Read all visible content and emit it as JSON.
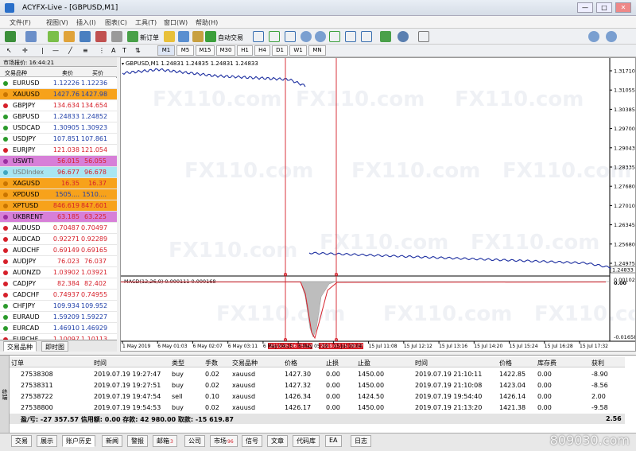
{
  "window": {
    "title": "ACYFX-Live - [GBPUSD,M1]",
    "min": "—",
    "max": "□",
    "close": "✕"
  },
  "menu": [
    "文件(F)",
    "视图(V)",
    "插入(I)",
    "图表(C)",
    "工具(T)",
    "窗口(W)",
    "帮助(H)"
  ],
  "toolbar": {
    "new_order": "新订单",
    "auto_trading": "自动交易",
    "timeframes": [
      "M1",
      "M5",
      "M15",
      "M30",
      "H1",
      "H4",
      "D1",
      "W1",
      "MN"
    ]
  },
  "market_watch": {
    "header": "市场报价: 16:44:21",
    "col_symbol": "交易品种",
    "col_bid": "卖价",
    "col_ask": "买价",
    "rows": [
      {
        "symbol": "EURUSD",
        "bid": "1.12226",
        "ask": "1.12236",
        "bg": "#ffffff",
        "dot": "#2b9a2b"
      },
      {
        "symbol": "XAUUSD",
        "bid": "1427.76",
        "ask": "1427.98",
        "bg": "#f7a21b",
        "dot": "#c87400"
      },
      {
        "symbol": "GBPJPY",
        "bid": "134.634",
        "ask": "134.654",
        "bg": "#ffffff",
        "dot": "#d6202a"
      },
      {
        "symbol": "GBPUSD",
        "bid": "1.24833",
        "ask": "1.24852",
        "bg": "#ffffff",
        "dot": "#2b9a2b"
      },
      {
        "symbol": "USDCAD",
        "bid": "1.30905",
        "ask": "1.30923",
        "bg": "#ffffff",
        "dot": "#2b9a2b"
      },
      {
        "symbol": "USDJPY",
        "bid": "107.851",
        "ask": "107.861",
        "bg": "#ffffff",
        "dot": "#2b9a2b"
      },
      {
        "symbol": "EURJPY",
        "bid": "121.038",
        "ask": "121.054",
        "bg": "#ffffff",
        "dot": "#d6202a"
      },
      {
        "symbol": "USWTI",
        "bid": "56.015",
        "ask": "56.055",
        "bg": "#d77fd8",
        "dot": "#9a2fa0"
      },
      {
        "symbol": "USDIndex",
        "bid": "96.677",
        "ask": "96.678",
        "bg": "#a8e6f2",
        "dot": "#3fa6c0"
      },
      {
        "symbol": "XAGUSD",
        "bid": "16.35",
        "ask": "16.37",
        "bg": "#f7a21b",
        "dot": "#c87400"
      },
      {
        "symbol": "XPDUSD",
        "bid": "1505....",
        "ask": "1510....",
        "bg": "#f7a21b",
        "dot": "#c87400"
      },
      {
        "symbol": "XPTUSD",
        "bid": "846.619",
        "ask": "847.601",
        "bg": "#f7a21b",
        "dot": "#c87400"
      },
      {
        "symbol": "UKBRENT",
        "bid": "63.185",
        "ask": "63.225",
        "bg": "#d77fd8",
        "dot": "#9a2fa0"
      },
      {
        "symbol": "AUDUSD",
        "bid": "0.70487",
        "ask": "0.70497",
        "bg": "#ffffff",
        "dot": "#d6202a"
      },
      {
        "symbol": "AUDCAD",
        "bid": "0.92271",
        "ask": "0.92289",
        "bg": "#ffffff",
        "dot": "#d6202a"
      },
      {
        "symbol": "AUDCHF",
        "bid": "0.69149",
        "ask": "0.69165",
        "bg": "#ffffff",
        "dot": "#d6202a"
      },
      {
        "symbol": "AUDJPY",
        "bid": "76.023",
        "ask": "76.037",
        "bg": "#ffffff",
        "dot": "#d6202a"
      },
      {
        "symbol": "AUDNZD",
        "bid": "1.03902",
        "ask": "1.03921",
        "bg": "#ffffff",
        "dot": "#d6202a"
      },
      {
        "symbol": "CADJPY",
        "bid": "82.384",
        "ask": "82.402",
        "bg": "#ffffff",
        "dot": "#d6202a"
      },
      {
        "symbol": "CADCHF",
        "bid": "0.74937",
        "ask": "0.74955",
        "bg": "#ffffff",
        "dot": "#d6202a"
      },
      {
        "symbol": "CHFJPY",
        "bid": "109.934",
        "ask": "109.952",
        "bg": "#ffffff",
        "dot": "#2b9a2b"
      },
      {
        "symbol": "EURAUD",
        "bid": "1.59209",
        "ask": "1.59227",
        "bg": "#ffffff",
        "dot": "#2b9a2b"
      },
      {
        "symbol": "EURCAD",
        "bid": "1.46910",
        "ask": "1.46929",
        "bg": "#ffffff",
        "dot": "#2b9a2b"
      },
      {
        "symbol": "EURCHF",
        "bid": "1.10097",
        "ask": "1.10113",
        "bg": "#ffffff",
        "dot": "#d6202a"
      }
    ],
    "tabs": [
      "交易品种",
      "即时图"
    ]
  },
  "chart": {
    "header": "GBPUSD,M1  1.24831 1.24835 1.24831 1.24833",
    "macd_label": "MACD(12,26,9) 0.000111 0.000168",
    "price_ticks": [
      "1.31710",
      "1.31055",
      "1.30385",
      "1.29700",
      "1.29043",
      "1.28335",
      "1.27680",
      "1.27010",
      "1.26345",
      "1.25680",
      "1.24975"
    ],
    "current_price": "1.24833",
    "macd_ticks": [
      "0.001026",
      "0.00",
      "-0.016587"
    ],
    "time_ticks": [
      "1 May 2019",
      "6 May 01:03",
      "6 May 02:07",
      "6 May 03:11",
      "6 May 04:15",
      "6 May 05:19",
      "15 Jul 10:04",
      "15 Jul 11:08",
      "15 Jul 12:12",
      "15 Jul 13:16",
      "15 Jul 14:20",
      "15 Jul 15:24",
      "15 Jul 16:28",
      "15 Jul 17:32"
    ],
    "marker1": "2019.05.06 05:14",
    "marker2": "2019.07.15 09:27",
    "colors": {
      "marker": "#d6202a",
      "price": "#1d2fa0",
      "macd_fill": "#bdbdbd",
      "signal": "#d6202a"
    },
    "watermark": "FX110.com"
  },
  "terminal": {
    "headers": [
      "订单",
      "时间",
      "类型",
      "手数",
      "交易品种",
      "价格",
      "止损",
      "止盈",
      "时间",
      "价格",
      "库存费",
      "获利"
    ],
    "rows": [
      [
        "27538308",
        "2019.07.19 19:27:47",
        "buy",
        "0.02",
        "xauusd",
        "1427.30",
        "0.00",
        "1450.00",
        "2019.07.19 21:10:11",
        "1422.85",
        "0.00",
        "-8.90"
      ],
      [
        "27538311",
        "2019.07.19 19:27:51",
        "buy",
        "0.02",
        "xauusd",
        "1427.32",
        "0.00",
        "1450.00",
        "2019.07.19 21:10:08",
        "1423.04",
        "0.00",
        "-8.56"
      ],
      [
        "27538722",
        "2019.07.19 19:47:54",
        "sell",
        "0.10",
        "xauusd",
        "1426.34",
        "0.00",
        "1424.50",
        "2019.07.19 19:54:40",
        "1426.14",
        "0.00",
        "2.00"
      ],
      [
        "27538800",
        "2019.07.19 19:54:53",
        "buy",
        "0.02",
        "xauusd",
        "1426.17",
        "0.00",
        "1450.00",
        "2019.07.19 21:13:20",
        "1421.38",
        "0.00",
        "-9.58"
      ]
    ],
    "summary": "盈/亏: -27 357.57  信用额: 0.00  存款: 42 980.00  取款: -15 619.87",
    "summary_total": "2.56",
    "tabs": [
      "交易",
      "展示",
      "账户历史",
      "新闻",
      "警报",
      "邮箱",
      "公司",
      "市场",
      "信号",
      "文章",
      "代码库",
      "EA",
      "日志"
    ],
    "mail_badge": "3",
    "market_badge": "96",
    "side_label": "终端"
  },
  "site_watermark": "809030.com"
}
